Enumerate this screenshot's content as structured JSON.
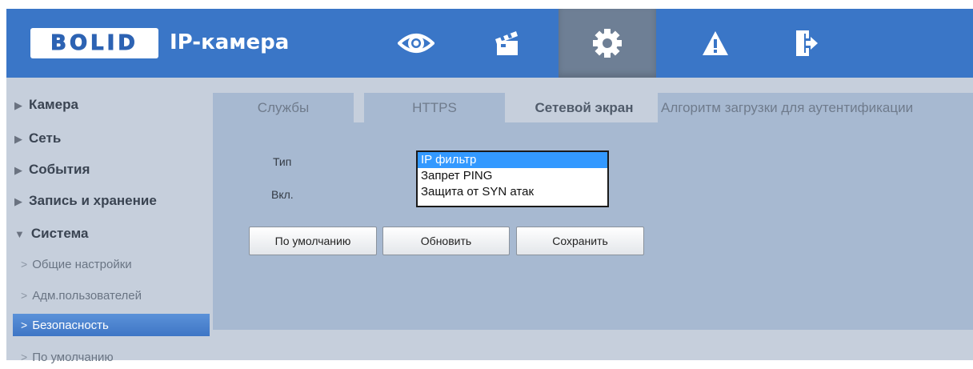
{
  "header": {
    "logo": "BOLID",
    "title": "IP-камера",
    "nav": [
      {
        "icon": "eye-icon",
        "active": false
      },
      {
        "icon": "clapperboard-icon",
        "active": false
      },
      {
        "icon": "gear-icon",
        "active": true
      },
      {
        "icon": "warning-icon",
        "active": false
      },
      {
        "icon": "logout-icon",
        "active": false
      }
    ]
  },
  "sidebar": {
    "sections": [
      {
        "label": "Камера",
        "expanded": false
      },
      {
        "label": "Сеть",
        "expanded": false
      },
      {
        "label": "События",
        "expanded": false
      },
      {
        "label": "Запись и хранение",
        "expanded": false
      },
      {
        "label": "Система",
        "expanded": true
      }
    ],
    "sub_items": [
      {
        "label": "Общие настройки",
        "active": false
      },
      {
        "label": "Адм.пользователей",
        "active": false
      },
      {
        "label": "Безопасность",
        "active": true
      },
      {
        "label": "По умолчанию",
        "active": false
      }
    ]
  },
  "tabs": [
    {
      "label": "Службы",
      "active": false
    },
    {
      "label": "HTTPS",
      "active": false
    },
    {
      "label": "Сетевой экран",
      "active": true
    },
    {
      "label": "Алгоритм загрузки для аутентификации",
      "active": false
    }
  ],
  "form": {
    "type_label": "Тип",
    "enable_label": "Вкл.",
    "type_options": [
      "IP фильтр",
      "Запрет PING",
      "Защита от SYN атак"
    ],
    "selected_option": "IP фильтр"
  },
  "buttons": {
    "default": "По умолчанию",
    "refresh": "Обновить",
    "save": "Сохранить"
  },
  "colors": {
    "header": "#3a76c7",
    "active_nav": "#6e7f95",
    "panel": "#a7b9d1",
    "content_bg": "#c6cfdc",
    "selection": "#3399ff"
  }
}
